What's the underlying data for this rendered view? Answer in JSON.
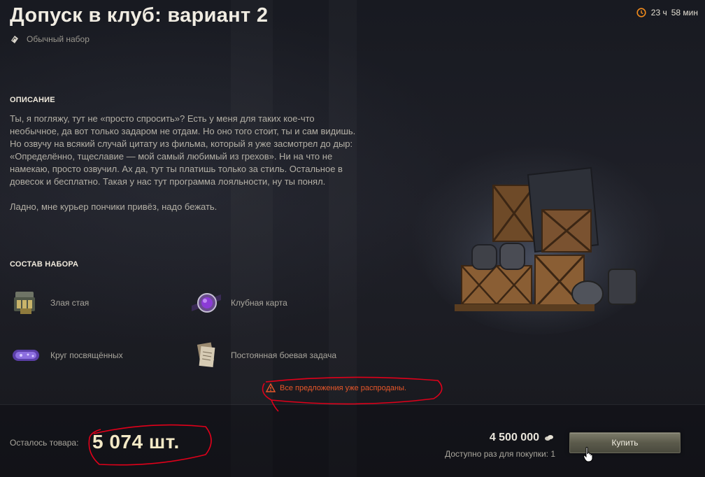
{
  "header": {
    "title": "Допуск в клуб: вариант 2",
    "subtitle": "Обычный набор",
    "timer_hours": "23 ч",
    "timer_minutes": "58 мин"
  },
  "description": {
    "heading": "ОПИСАНИЕ",
    "text": "Ты, я погляжу, тут не «просто спросить»? Есть у меня для таких кое-что необычное, да вот только задаром не отдам. Но оно того стоит, ты и сам видишь. Но озвучу на всякий случай цитату из фильма, который я уже засмотрел до дыр: «Определённо, тщеславие — мой самый любимый из грехов». Ни на что не намекаю, просто озвучил. Ах да, тут ты платишь только за стиль. Остальное в довесок и бесплатно. Такая у нас тут программа лояльности, ну ты понял.\n\nЛадно, мне курьер пончики привёз, надо бежать."
  },
  "bundle": {
    "heading": "СОСТАВ НАБОРА",
    "items": [
      {
        "label": "Злая стая",
        "icon": "ammo-box-icon"
      },
      {
        "label": "Клубная карта",
        "icon": "club-card-icon"
      },
      {
        "label": "Круг посвящённых",
        "icon": "purple-emblem-icon"
      },
      {
        "label": "Постоянная боевая задача",
        "icon": "documents-icon"
      }
    ]
  },
  "notice": {
    "text": "Все предложения уже распроданы."
  },
  "footer": {
    "stock_label": "Осталось товара:",
    "stock_value": "5 074 шт.",
    "price": "4 500 000",
    "purchase_limit": "Доступно раз для покупки: 1",
    "buy_label": "Купить"
  },
  "colors": {
    "warning": "#e8572a",
    "timer_icon": "#f08a1c",
    "annotation": "#e0001a",
    "stock_value": "#f3e9c6"
  }
}
